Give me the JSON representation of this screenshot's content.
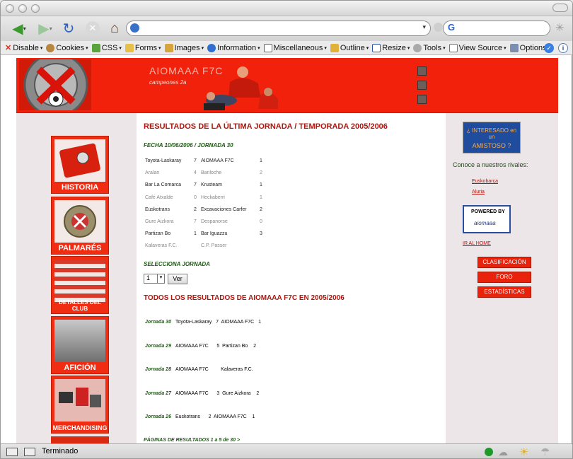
{
  "browser": {
    "toolbar": [
      "Disable",
      "Cookies",
      "CSS",
      "Forms",
      "Images",
      "Information",
      "Miscellaneous",
      "Outline",
      "Resize",
      "Tools",
      "View Source",
      "Options"
    ],
    "search_engine": "G",
    "status": "Terminado"
  },
  "header": {
    "title": "AIOMAAA F7C",
    "subtitle": "campeones 2a"
  },
  "sidebar": {
    "items": [
      {
        "label": "HISTORIA"
      },
      {
        "label": "PALMARÉS"
      },
      {
        "label": "DETALLES DEL CLUB"
      },
      {
        "label": "AFICIÓN"
      },
      {
        "label": "MERCHANDISING"
      }
    ]
  },
  "main": {
    "title": "RESULTADOS DE LA ÚLTIMA JORNADA / TEMPORADA 2005/2006",
    "fecha": "FECHA 10/06/2006 / JORNADA 30",
    "results": [
      {
        "home": "Toyota-Laskaray",
        "hs": "7",
        "away": "AIOMAAA F7C",
        "as": "1",
        "dark": true
      },
      {
        "home": "Aralan",
        "hs": "4",
        "away": "Bariloche",
        "as": "2",
        "dark": false
      },
      {
        "home": "Bar La Comarca",
        "hs": "7",
        "away": "Krusteam",
        "as": "1",
        "dark": true
      },
      {
        "home": "Café Atxalde",
        "hs": "0",
        "away": "Heckaberri",
        "as": "1",
        "dark": false
      },
      {
        "home": "Euskotrans",
        "hs": "2",
        "away": "Excavaciones Carfer",
        "as": "2",
        "dark": true
      },
      {
        "home": "Gure Aizkora",
        "hs": "7",
        "away": "Despanorse",
        "as": "0",
        "dark": false
      },
      {
        "home": "Partizan Bo",
        "hs": "1",
        "away": "Bar Iguazzu",
        "as": "3",
        "dark": true
      },
      {
        "home": "Kalaveras F.C.",
        "hs": "",
        "away": "C.P. Passer",
        "as": "",
        "dark": false
      }
    ],
    "selecciona": "SELECCIONA JORNADA",
    "select_value": "1",
    "ver_button": "Ver",
    "todos_title": "TODOS LOS RESULTADOS DE AIOMAAA F7C EN 2005/2006",
    "jornadas": [
      {
        "jornada": "Jornada 30",
        "text": "Toyota-Laskaray   7  AIOMAAA F7C   1"
      },
      {
        "jornada": "Jornada 29",
        "text": "AIOMAAA F7C      5  Partizan Bo    2"
      },
      {
        "jornada": "Jornada 28",
        "text": "AIOMAAA F7C         Kalaveras F.C."
      },
      {
        "jornada": "Jornada 27",
        "text": "AIOMAAA F7C      3  Gure Aizkora    2"
      },
      {
        "jornada": "Jornada 26",
        "text": "Euskotrans      2  AIOMAAA F7C    1"
      }
    ],
    "paginas": "PÁGINAS DE RESULTADOS 1 a 5 de 30 >"
  },
  "right": {
    "amistoso_line1": "¿ INTERESADO en un",
    "amistoso_line2": "AMISTOSO ?",
    "conoce": "Conoce a nuestros rivales:",
    "rivales": [
      "Euskobarça",
      "Aluria"
    ],
    "powered_by": "POWERED BY",
    "powered_brand": "aiomaaa",
    "ir_home": "IR AL HOME",
    "buttons": [
      "CLASIFICACIÓN",
      "FORO",
      "ESTADÍSTICAS"
    ]
  }
}
